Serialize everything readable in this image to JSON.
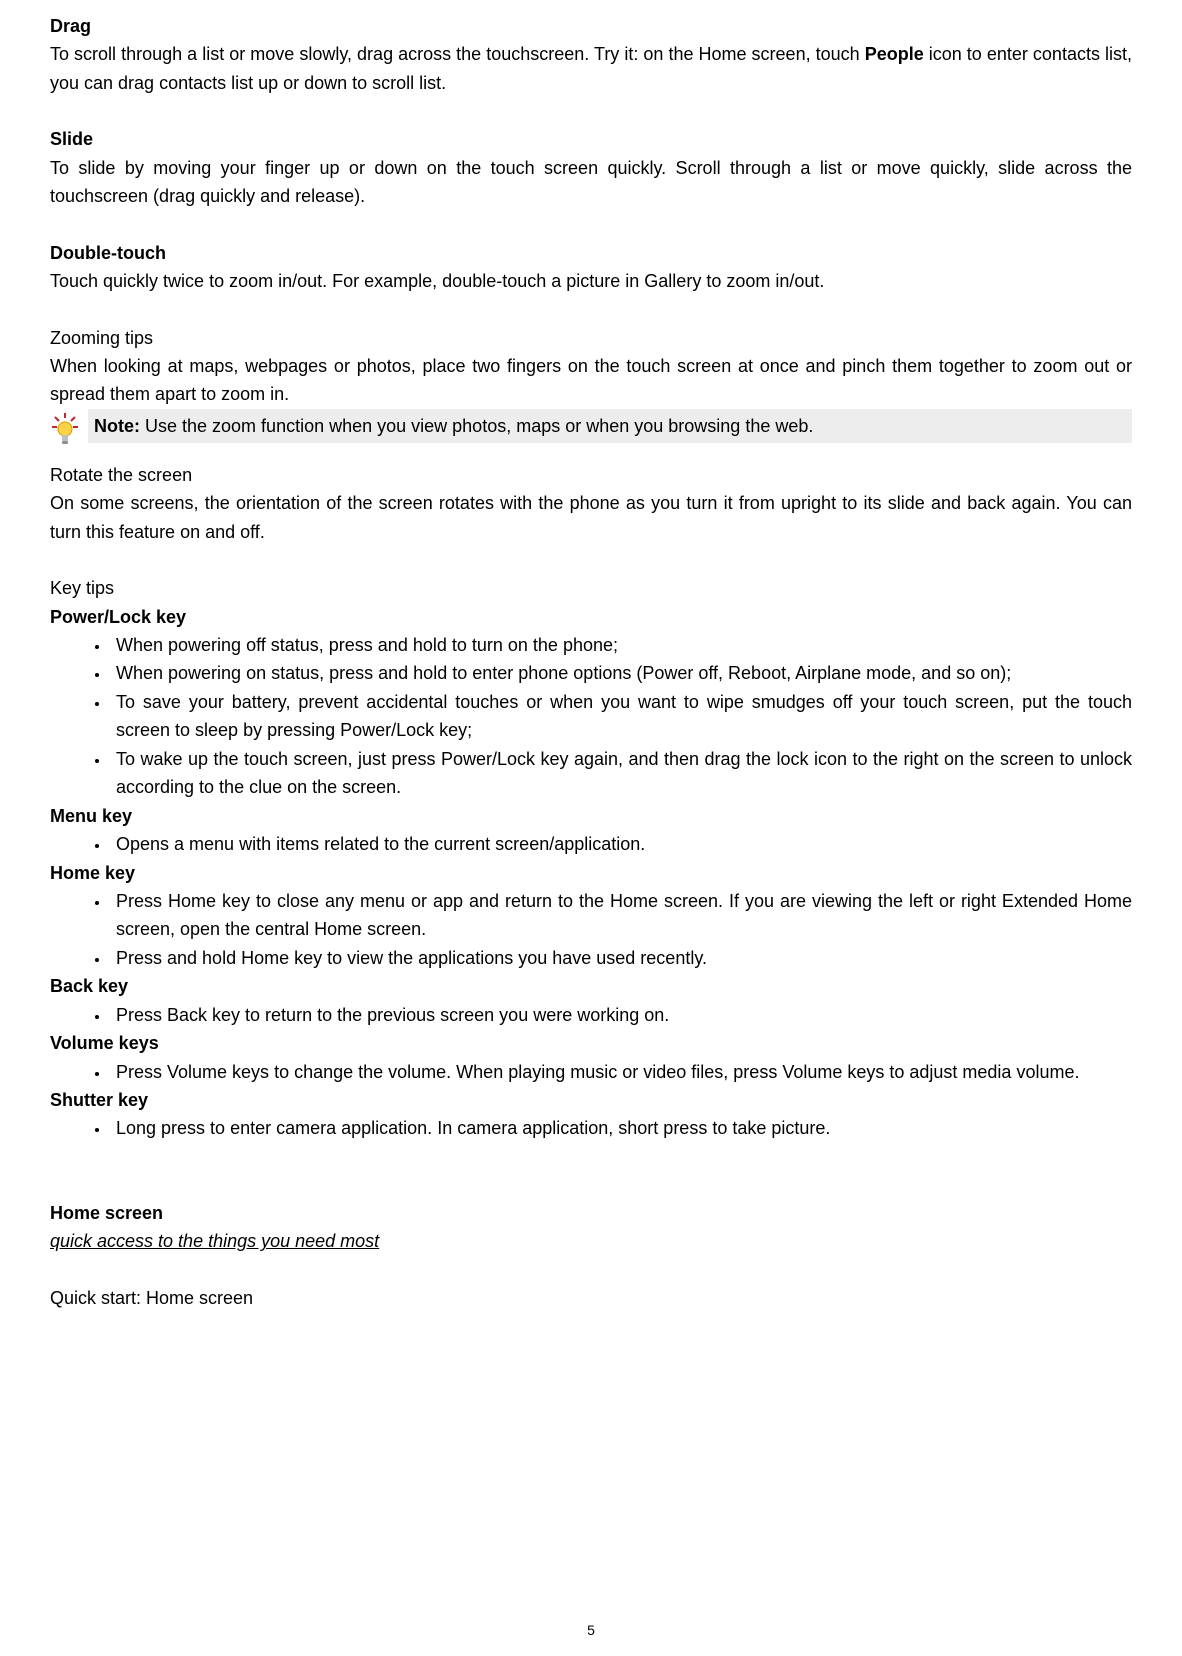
{
  "drag": {
    "heading": "Drag",
    "line1a": "To scroll through a list or move slowly, drag across the touchscreen. Try it: on the Home screen, touch ",
    "peopleWord": "People",
    "line1b": " icon to enter contacts list, you can drag contacts list up or down to scroll list."
  },
  "slide": {
    "heading": "Slide",
    "text": "To slide by moving your finger up or down on the touch screen quickly. Scroll through a list or move quickly, slide across the touchscreen (drag quickly and release)."
  },
  "doubleTouch": {
    "heading": "Double-touch",
    "text": "Touch quickly twice to zoom in/out. For example, double-touch a picture in Gallery to zoom in/out."
  },
  "zooming": {
    "heading": "Zooming tips",
    "text": "When looking at maps, webpages or photos, place two fingers on the touch screen at once and pinch them together to zoom out or spread them apart to zoom in.",
    "noteLabel": "Note:",
    "noteBody": " Use the zoom function when you view photos, maps or when you browsing the web."
  },
  "rotate": {
    "heading": "Rotate the screen",
    "text": "On some screens, the orientation of the screen rotates with the phone as you turn it from upright to its slide and back again. You can turn this feature on and off."
  },
  "keyTips": {
    "heading": "Key tips",
    "power": {
      "heading": "Power/Lock key",
      "items": [
        "When powering off status, press and hold to turn on the phone;",
        "When powering on status, press and hold to enter phone options (Power off, Reboot, Airplane mode, and so on);",
        "To save your battery, prevent accidental touches or when you want to wipe smudges off your touch screen, put the touch screen to sleep by pressing Power/Lock key;",
        "To wake up the touch screen, just press Power/Lock key again, and then drag the lock icon to the right on the screen to unlock according to the clue on the screen."
      ]
    },
    "menu": {
      "heading": "Menu key",
      "items": [
        "Opens a menu with items related to the current screen/application."
      ]
    },
    "home": {
      "heading": "Home key",
      "items": [
        "Press Home key to close any menu or app and return to the Home screen. If you are viewing the left or right Extended Home screen, open the central Home screen.",
        "Press and hold Home key to view the applications you have used recently."
      ]
    },
    "back": {
      "heading": "Back key",
      "items": [
        "Press Back key to return to the previous screen you were working on."
      ]
    },
    "volume": {
      "heading": "Volume keys",
      "items": [
        "Press Volume keys to change the volume. When playing music or video files, press Volume keys to adjust media volume."
      ]
    },
    "shutter": {
      "heading": "Shutter key",
      "items": [
        "Long press to enter camera application. In camera application, short press to take picture."
      ]
    }
  },
  "homeScreen": {
    "heading": "Home screen",
    "sub": "quick access to the things you need most",
    "quickStart": "Quick start: Home screen"
  },
  "pageNumber": "5"
}
